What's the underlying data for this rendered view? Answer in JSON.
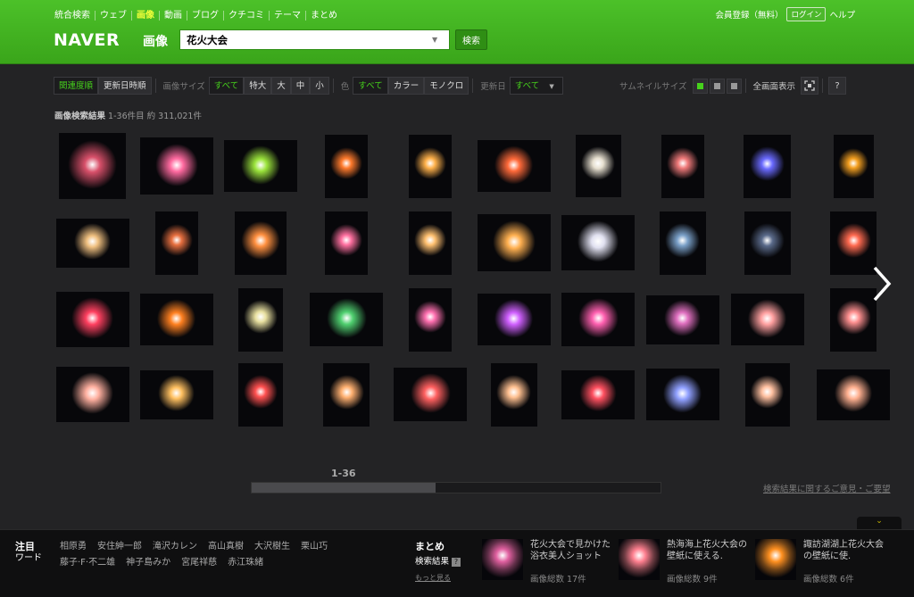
{
  "header": {
    "nav": [
      "統合検索",
      "ウェブ",
      "画像",
      "動画",
      "ブログ",
      "クチコミ",
      "テーマ",
      "まとめ"
    ],
    "nav_active": 2,
    "user": {
      "register": "会員登録（無料）",
      "login": "ログイン",
      "help": "ヘルプ"
    },
    "logo": "NAVER",
    "service": "画像",
    "search_value": "花火大会",
    "search_button": "検索"
  },
  "filters": {
    "sort_relevance": "関連度順",
    "sort_updated": "更新日時順",
    "size_label": "画像サイズ",
    "size_all": "すべて",
    "size_xl": "特大",
    "size_l": "大",
    "size_m": "中",
    "size_s": "小",
    "color_label": "色",
    "color_all": "すべて",
    "color_color": "カラー",
    "color_mono": "モノクロ",
    "date_label": "更新日",
    "date_value": "すべて",
    "thumb_label": "サムネイルサイズ",
    "fullscreen_label": "全画面表示",
    "help": "?"
  },
  "results": {
    "title": "画像検索結果",
    "range": "1-36件目",
    "total": "約 311,021件"
  },
  "images": [
    {
      "row": 0,
      "c": "#d8506a"
    },
    {
      "row": 0,
      "c": "#ff6aa0"
    },
    {
      "row": 0,
      "c": "#9be43c"
    },
    {
      "row": 0,
      "c": "#ff7a2c"
    },
    {
      "row": 0,
      "c": "#ffb14a"
    },
    {
      "row": 0,
      "c": "#ff6a3a"
    },
    {
      "row": 0,
      "c": "#e7e0d0"
    },
    {
      "row": 0,
      "c": "#f07a7a"
    },
    {
      "row": 0,
      "c": "#6a6aff"
    },
    {
      "row": 0,
      "c": "#f5a020"
    },
    {
      "row": 1,
      "c": "#f0c080"
    },
    {
      "row": 1,
      "c": "#e87040"
    },
    {
      "row": 1,
      "c": "#ff9040"
    },
    {
      "row": 1,
      "c": "#ff70a0"
    },
    {
      "row": 1,
      "c": "#ffc070"
    },
    {
      "row": 1,
      "c": "#ffb050"
    },
    {
      "row": 1,
      "c": "#e0e0f0"
    },
    {
      "row": 1,
      "c": "#7aa0c8"
    },
    {
      "row": 1,
      "c": "#5a6a8a"
    },
    {
      "row": 1,
      "c": "#ff6a50"
    },
    {
      "row": 2,
      "c": "#ff4060"
    },
    {
      "row": 2,
      "c": "#ff8020"
    },
    {
      "row": 2,
      "c": "#e8e0a0"
    },
    {
      "row": 2,
      "c": "#50d070"
    },
    {
      "row": 2,
      "c": "#ff70b0"
    },
    {
      "row": 2,
      "c": "#d060ff"
    },
    {
      "row": 2,
      "c": "#ff60b0"
    },
    {
      "row": 2,
      "c": "#e070c0"
    },
    {
      "row": 2,
      "c": "#ffa0a0"
    },
    {
      "row": 2,
      "c": "#ff9090"
    },
    {
      "row": 3,
      "c": "#ffb0a0"
    },
    {
      "row": 3,
      "c": "#ffc060"
    },
    {
      "row": 3,
      "c": "#ff5050"
    },
    {
      "row": 3,
      "c": "#ffb070"
    },
    {
      "row": 3,
      "c": "#ff6060"
    },
    {
      "row": 3,
      "c": "#ffc090"
    },
    {
      "row": 3,
      "c": "#ff5060"
    },
    {
      "row": 3,
      "c": "#90a0ff"
    },
    {
      "row": 3,
      "c": "#ffc0a0"
    },
    {
      "row": 3,
      "c": "#ffb090"
    }
  ],
  "pagination": {
    "label": "1-36",
    "position": 0.45
  },
  "feedback": "検索結果に関するご意見・ご要望",
  "trending": {
    "title": "注目",
    "subtitle": "ワード",
    "words": [
      "相原勇",
      "安住紳一郎",
      "滝沢カレン",
      "高山真樹",
      "大沢樹生",
      "栗山巧",
      "藤子·F·不二雄",
      "神子島みか",
      "宮尾祥慈",
      "赤江珠緒"
    ]
  },
  "matome": {
    "title": "まとめ",
    "subtitle": "検索結果",
    "help": "?",
    "more": "もっと見る",
    "cards": [
      {
        "text": "花火大会で見かけた浴衣美人ショット",
        "count": "画像総数 17件",
        "c": "#e060a0"
      },
      {
        "text": "熱海海上花火大会の壁紙に使える.",
        "count": "画像総数 9件",
        "c": "#ff8090"
      },
      {
        "text": "諏訪湖湖上花火大会の壁紙に使.",
        "count": "画像総数 6件",
        "c": "#ff9020"
      }
    ]
  },
  "colors": {
    "brand": "#3aa51a",
    "accent": "#46d11c",
    "background": "#232325"
  }
}
